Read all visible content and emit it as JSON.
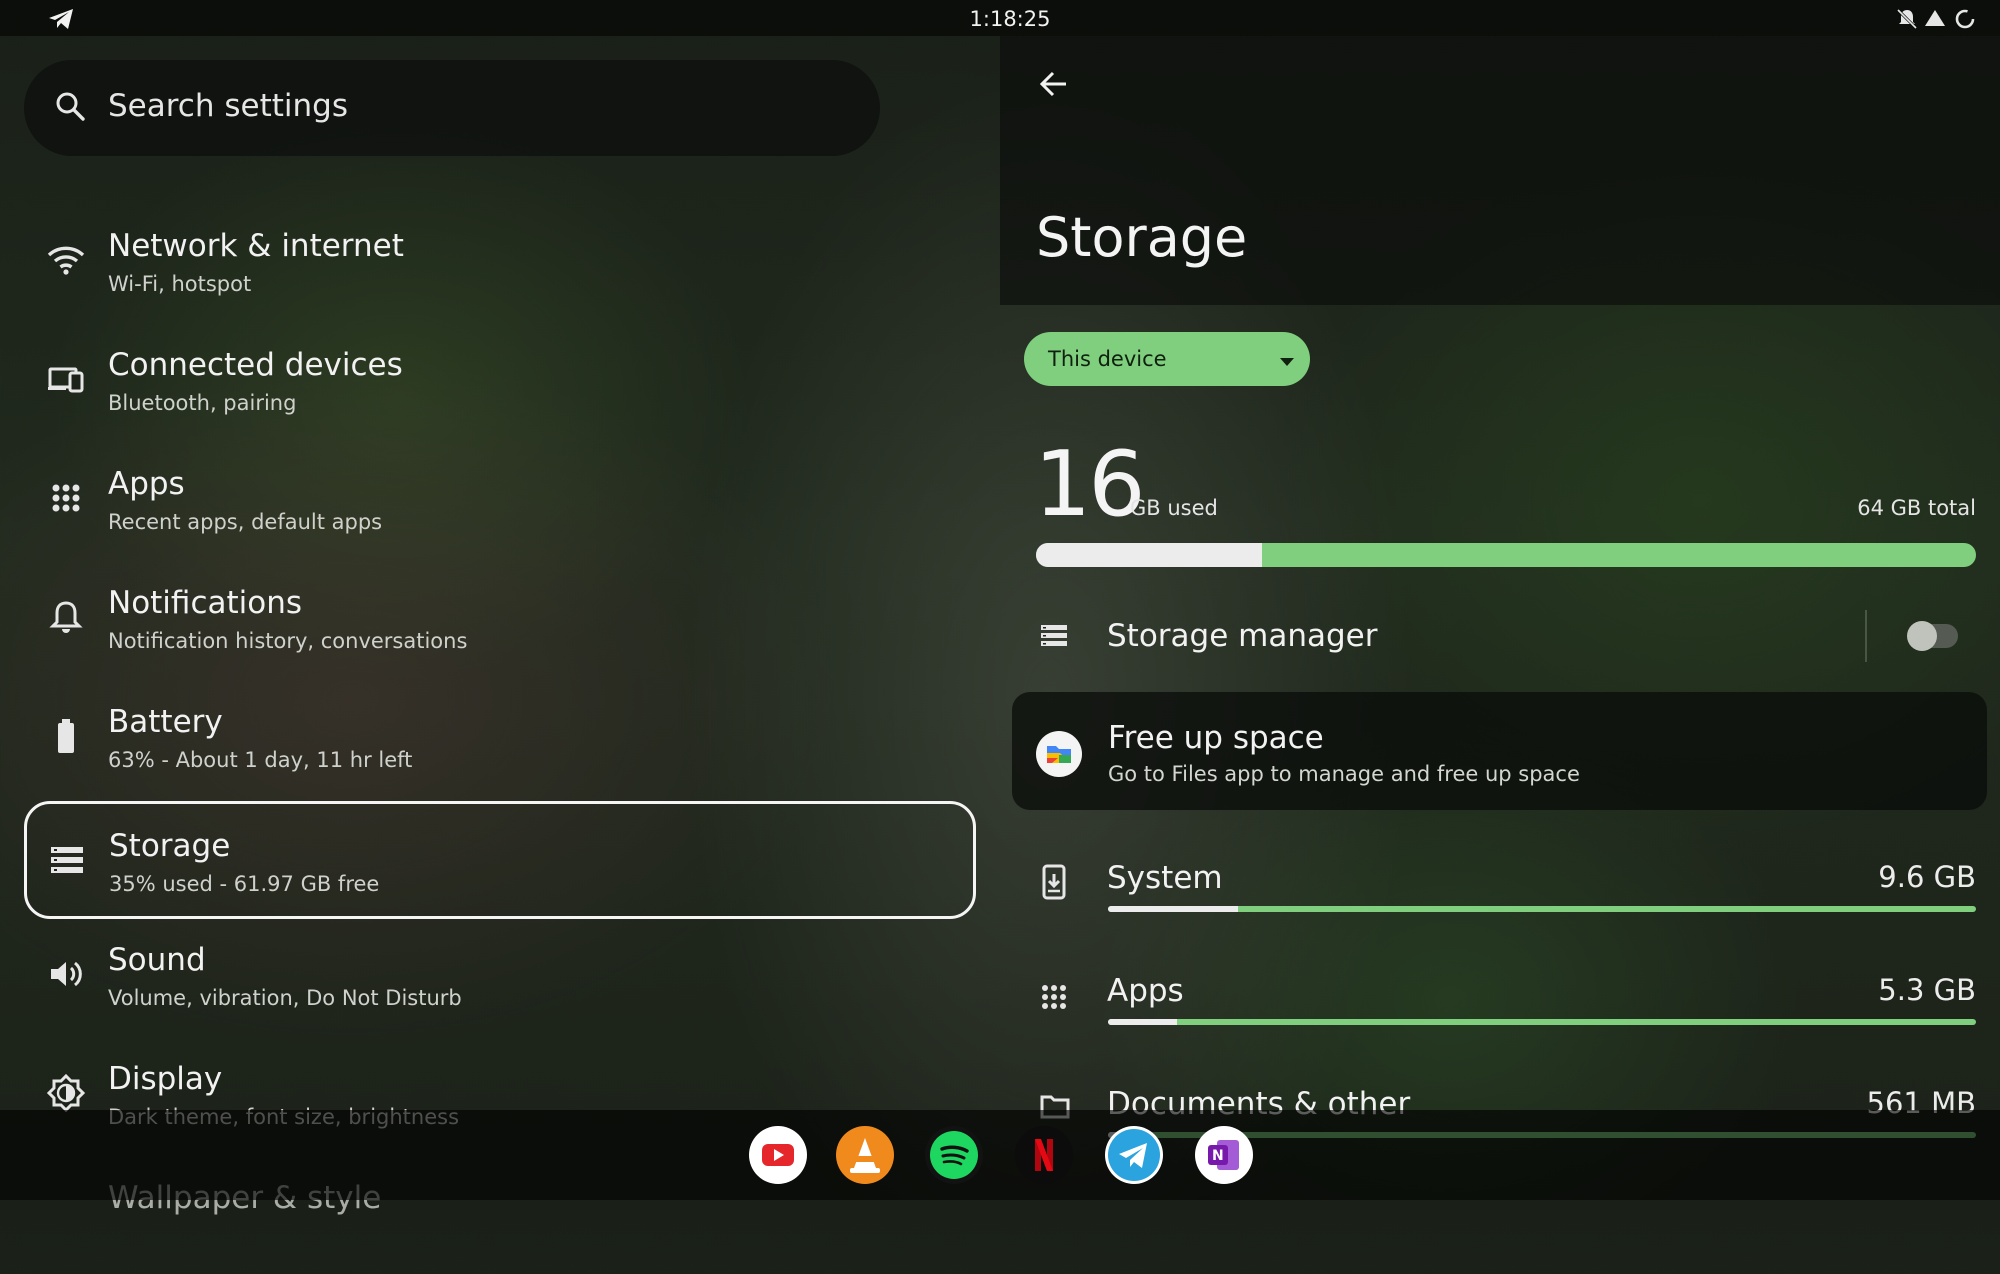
{
  "status_bar": {
    "time": "1:18:25"
  },
  "search": {
    "placeholder": "Search settings"
  },
  "menu": [
    {
      "title": "Network & internet",
      "subtitle": "Wi-Fi, hotspot",
      "icon": "wifi-icon"
    },
    {
      "title": "Connected devices",
      "subtitle": "Bluetooth, pairing",
      "icon": "devices-icon"
    },
    {
      "title": "Apps",
      "subtitle": "Recent apps, default apps",
      "icon": "apps-grid-icon"
    },
    {
      "title": "Notifications",
      "subtitle": "Notification history, conversations",
      "icon": "bell-icon"
    },
    {
      "title": "Battery",
      "subtitle": "63% - About 1 day, 11 hr left",
      "icon": "battery-icon"
    },
    {
      "title": "Storage",
      "subtitle": "35% used - 61.97 GB free",
      "icon": "storage-icon",
      "selected": true
    },
    {
      "title": "Sound",
      "subtitle": "Volume, vibration, Do Not Disturb",
      "icon": "speaker-icon"
    },
    {
      "title": "Display",
      "subtitle": "Dark theme, font size, brightness",
      "icon": "brightness-icon"
    },
    {
      "title": "Wallpaper & style",
      "subtitle": "",
      "icon": "palette-icon"
    }
  ],
  "storage": {
    "title": "Storage",
    "device": "This device",
    "used_number": "16",
    "used_unit": "GB used",
    "total": "64 GB total",
    "used_fraction": 0.24,
    "manager_label": "Storage manager",
    "manager_enabled": false,
    "free_up": {
      "title": "Free up space",
      "subtitle": "Go to Files app to manage and free up space"
    },
    "categories": [
      {
        "name": "System",
        "size": "9.6 GB",
        "fraction": 0.15,
        "icon": "system-update-icon"
      },
      {
        "name": "Apps",
        "size": "5.3 GB",
        "fraction": 0.08,
        "icon": "apps-grid-icon"
      },
      {
        "name": "Documents & other",
        "size": "561 MB",
        "fraction": 0.01,
        "icon": "folder-icon"
      }
    ]
  },
  "dock": [
    {
      "name": "youtube-app-icon",
      "color": "#ffffff"
    },
    {
      "name": "vlc-app-icon",
      "color": "#f08a1d"
    },
    {
      "name": "spotify-app-icon",
      "color": "#1ed760"
    },
    {
      "name": "netflix-app-icon",
      "color": "#e50914"
    },
    {
      "name": "telegram-app-icon",
      "color": "#2aa3df"
    },
    {
      "name": "onenote-app-icon",
      "color": "#7719aa"
    }
  ],
  "colors": {
    "accent": "#7fcf7e",
    "bar_used": "#ececec"
  }
}
